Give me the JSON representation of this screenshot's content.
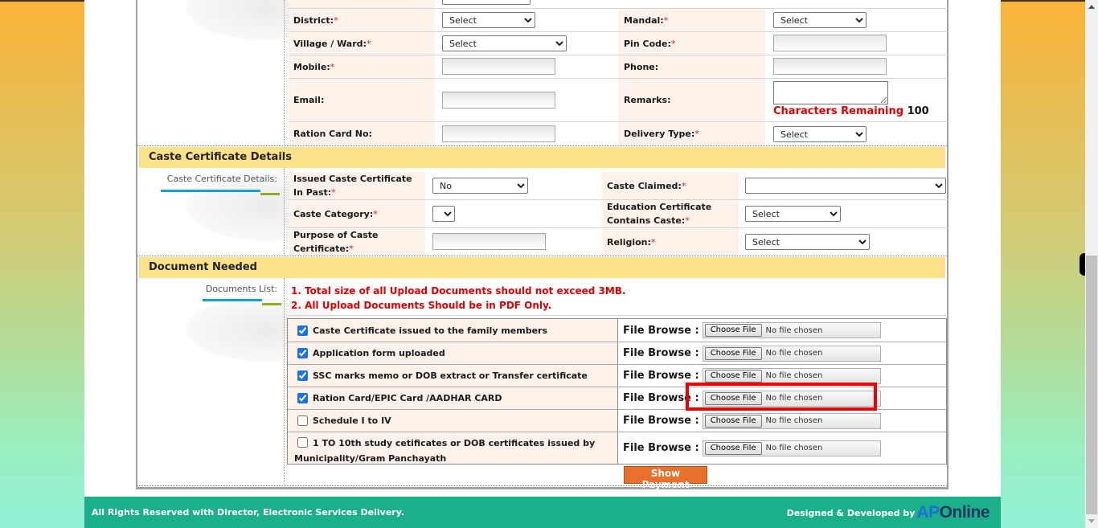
{
  "contact_section": {
    "rows": [
      {
        "left_label": "District:",
        "left_required": true,
        "left_value": "Select",
        "right_label": "Mandal:",
        "right_required": true,
        "right_value": "Select"
      },
      {
        "left_label": "Village / Ward:",
        "left_required": true,
        "left_value": "Select",
        "right_label": "Pin Code:",
        "right_required": true,
        "right_value": ""
      },
      {
        "left_label": "Mobile:",
        "left_required": true,
        "left_value": "",
        "right_label": "Phone:",
        "right_required": false,
        "right_value": ""
      },
      {
        "left_label": "Email:",
        "left_required": false,
        "left_value": "",
        "right_label": "Remarks:",
        "right_required": false,
        "right_value": ""
      },
      {
        "left_label": "Ration Card No:",
        "left_required": false,
        "left_value": "",
        "right_label": "Delivery Type:",
        "right_required": true,
        "right_value": "Select"
      }
    ],
    "chars_remaining_label": "Characters Remaining",
    "chars_remaining_value": "100"
  },
  "caste_section": {
    "title": "Caste Certificate Details",
    "side_label": "Caste Certificate Details:",
    "issued_label": "Issued Caste Certificate In Past:",
    "issued_value": "No",
    "caste_claimed_label": "Caste Claimed:",
    "caste_claimed_value": "",
    "caste_category_label": "Caste Category:",
    "caste_category_value": "",
    "edu_cert_label": "Education Certificate Contains Caste:",
    "edu_cert_value": "Select",
    "purpose_label": "Purpose of Caste Certificate:",
    "purpose_value": "",
    "religion_label": "Religion:",
    "religion_value": "Select",
    "required_mark": "*"
  },
  "documents_section": {
    "title": "Document Needed",
    "side_label": "Documents List:",
    "notes": [
      "1. Total size of all Upload Documents should not exceed 3MB.",
      "2. All Upload Documents Should be in PDF Only."
    ],
    "file_browse_label": "File Browse :",
    "choose_file_label": "Choose File",
    "no_file_label": "No file chosen",
    "documents": [
      {
        "label": "Caste Certificate issued to the family members",
        "checked": true
      },
      {
        "label": "Application form uploaded",
        "checked": true
      },
      {
        "label": "SSC marks memo or DOB extract or Transfer certificate",
        "checked": true
      },
      {
        "label": "Ration Card/EPIC Card /AADHAR CARD",
        "checked": true,
        "highlighted": true
      },
      {
        "label": "Schedule I to IV",
        "checked": false
      },
      {
        "label": "1 TO 10th study cetificates or DOB certificates issued by Municipality/Gram Panchayath",
        "checked": false
      }
    ],
    "show_payment_label": "Show Payment"
  },
  "footer": {
    "rights": "All Rights Reserved with Director, Electronic Services Delivery.",
    "designed_by": "Designed & Developed by",
    "logo_ap": "AP",
    "logo_online": "Online"
  },
  "colors": {
    "section_header": "#fde28a",
    "label_bg": "#fdf2ea",
    "required": "#e0103a",
    "note_red": "#e00000",
    "footer": "#1bb089",
    "button_orange": "#e8702a",
    "highlight": "#ee0000"
  }
}
